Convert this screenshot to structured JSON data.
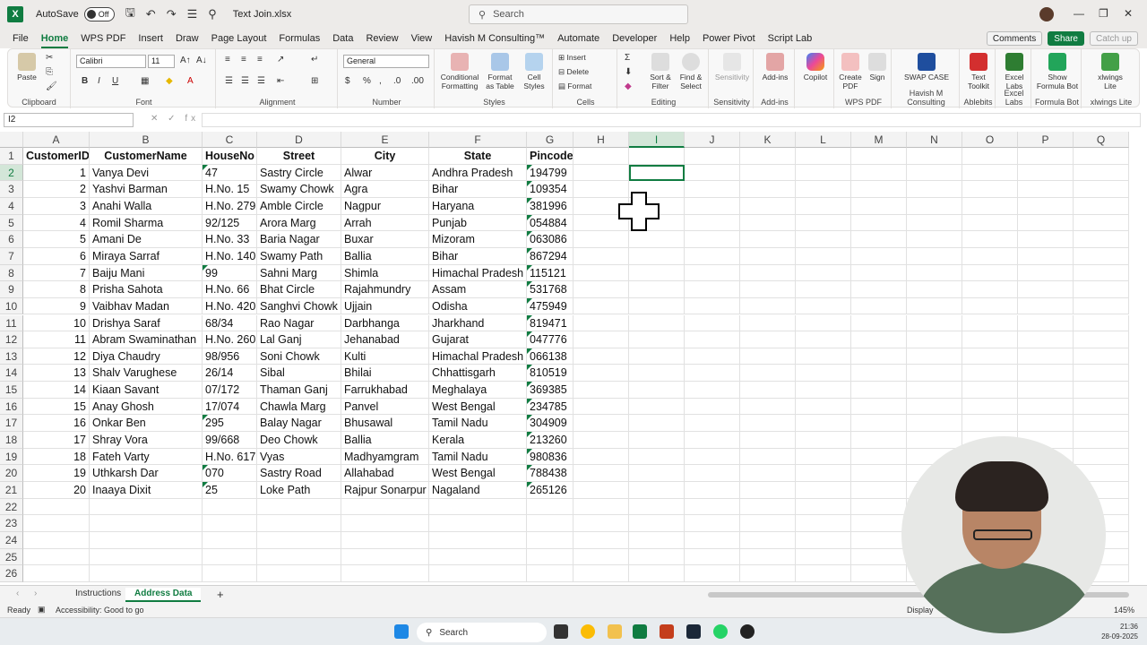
{
  "titlebar": {
    "autosave_label": "AutoSave",
    "autosave_state": "Off",
    "filename": "Text Join.xlsx",
    "search_placeholder": "Search"
  },
  "ribbon_tabs": [
    "File",
    "Home",
    "WPS PDF",
    "Insert",
    "Draw",
    "Page Layout",
    "Formulas",
    "Data",
    "Review",
    "View",
    "Havish M Consulting™",
    "Automate",
    "Developer",
    "Help",
    "Power Pivot",
    "Script Lab"
  ],
  "active_tab": "Home",
  "right_buttons": {
    "comments": "Comments",
    "share": "Share",
    "catchup": "Catch up"
  },
  "ribbon": {
    "clipboard": {
      "paste": "Paste",
      "label": "Clipboard"
    },
    "font": {
      "name": "Calibri",
      "size": "11",
      "label": "Font"
    },
    "alignment": {
      "label": "Alignment"
    },
    "number": {
      "format": "General",
      "label": "Number"
    },
    "styles": {
      "conditional": "Conditional Formatting",
      "format_table": "Format as Table",
      "cell_styles": "Cell Styles",
      "label": "Styles"
    },
    "cells": {
      "insert": "Insert",
      "delete": "Delete",
      "format": "Format",
      "label": "Cells"
    },
    "editing": {
      "sort": "Sort & Filter",
      "find": "Find & Select",
      "label": "Editing"
    },
    "sensitivity": {
      "item": "Sensitivity",
      "label": "Sensitivity"
    },
    "addins": {
      "item": "Add-ins",
      "label": "Add-ins"
    },
    "copilot": {
      "item": "Copilot"
    },
    "wps": {
      "create": "Create PDF",
      "sign": "Sign",
      "label": "WPS PDF"
    },
    "havish": {
      "swap": "SWAP CASE",
      "label": "Havish M Consulting"
    },
    "ablebits": {
      "item": "Text Toolkit",
      "label": "Ablebits"
    },
    "excellabs": {
      "item": "Excel Labs",
      "label": "Excel Labs"
    },
    "formulabot": {
      "item": "Show Formula Bot",
      "label": "Formula Bot"
    },
    "xlwings": {
      "item": "xlwings Lite",
      "label": "xlwings Lite"
    }
  },
  "formula_bar": {
    "name_box": "I2",
    "fx": "✕ ✓ fx",
    "content": ""
  },
  "columns": [
    "A",
    "B",
    "C",
    "D",
    "E",
    "F",
    "G",
    "H",
    "I",
    "J",
    "K",
    "L",
    "M",
    "N",
    "O",
    "P",
    "Q"
  ],
  "rows": [
    "1",
    "2",
    "3",
    "4",
    "5",
    "6",
    "7",
    "8",
    "9",
    "10",
    "11",
    "12",
    "13",
    "14",
    "15",
    "16",
    "17",
    "18",
    "19",
    "20",
    "21",
    "22",
    "23",
    "24",
    "25",
    "26"
  ],
  "table": {
    "headers": [
      "CustomerID",
      "CustomerName",
      "HouseNo",
      "Street",
      "City",
      "State",
      "Pincode"
    ],
    "rows": [
      [
        "1",
        "Vanya Devi",
        "47",
        "Sastry Circle",
        "Alwar",
        "Andhra Pradesh",
        "194799"
      ],
      [
        "2",
        "Yashvi Barman",
        "H.No. 15",
        "Swamy Chowk",
        "Agra",
        "Bihar",
        "109354"
      ],
      [
        "3",
        "Anahi Walla",
        "H.No. 279",
        "Amble Circle",
        "Nagpur",
        "Haryana",
        "381996"
      ],
      [
        "4",
        "Romil Sharma",
        "92/125",
        "Arora Marg",
        "Arrah",
        "Punjab",
        "054884"
      ],
      [
        "5",
        "Amani De",
        "H.No. 33",
        "Baria Nagar",
        "Buxar",
        "Mizoram",
        "063086"
      ],
      [
        "6",
        "Miraya Sarraf",
        "H.No. 140",
        "Swamy Path",
        "Ballia",
        "Bihar",
        "867294"
      ],
      [
        "7",
        "Baiju Mani",
        "99",
        "Sahni Marg",
        "Shimla",
        "Himachal Pradesh",
        "115121"
      ],
      [
        "8",
        "Prisha Sahota",
        "H.No. 66",
        "Bhat Circle",
        "Rajahmundry",
        "Assam",
        "531768"
      ],
      [
        "9",
        "Vaibhav Madan",
        "H.No. 420",
        "Sanghvi Chowk",
        "Ujjain",
        "Odisha",
        "475949"
      ],
      [
        "10",
        "Drishya Saraf",
        "68/34",
        "Rao Nagar",
        "Darbhanga",
        "Jharkhand",
        "819471"
      ],
      [
        "11",
        "Abram Swaminathan",
        "H.No. 260",
        "Lal Ganj",
        "Jehanabad",
        "Gujarat",
        "047776"
      ],
      [
        "12",
        "Diya Chaudry",
        "98/956",
        "Soni Chowk",
        "Kulti",
        "Himachal Pradesh",
        "066138"
      ],
      [
        "13",
        "Shalv Varughese",
        "26/14",
        "Sibal",
        "Bhilai",
        "Chhattisgarh",
        "810519"
      ],
      [
        "14",
        "Kiaan Savant",
        "07/172",
        "Thaman Ganj",
        "Farrukhabad",
        "Meghalaya",
        "369385"
      ],
      [
        "15",
        "Anay Ghosh",
        "17/074",
        "Chawla Marg",
        "Panvel",
        "West Bengal",
        "234785"
      ],
      [
        "16",
        "Onkar Ben",
        "295",
        "Balay Nagar",
        "Bhusawal",
        "Tamil Nadu",
        "304909"
      ],
      [
        "17",
        "Shray Vora",
        "99/668",
        "Deo Chowk",
        "Ballia",
        "Kerala",
        "213260"
      ],
      [
        "18",
        "Fateh Varty",
        "H.No. 617",
        "Vyas",
        "Madhyamgram",
        "Tamil Nadu",
        "980836"
      ],
      [
        "19",
        "Uthkarsh Dar",
        "070",
        "Sastry Road",
        "Allahabad",
        "West Bengal",
        "788438"
      ],
      [
        "20",
        "Inaaya  Dixit",
        "25",
        "Loke Path",
        "Rajpur Sonarpur",
        "Nagaland",
        "265126"
      ]
    ]
  },
  "sheets": [
    "Instructions",
    "Address Data"
  ],
  "active_sheet": "Address Data",
  "status": {
    "ready": "Ready",
    "accessibility": "Accessibility: Good to go",
    "display": "Display",
    "zoom": "145%"
  },
  "taskbar": {
    "search": "Search",
    "time": "21:36",
    "date": "28-09-2025"
  },
  "colors": {
    "excel_green": "#107c41",
    "ribbon_bg": "#f8f8f8",
    "titlebar_bg": "#edebe9"
  }
}
